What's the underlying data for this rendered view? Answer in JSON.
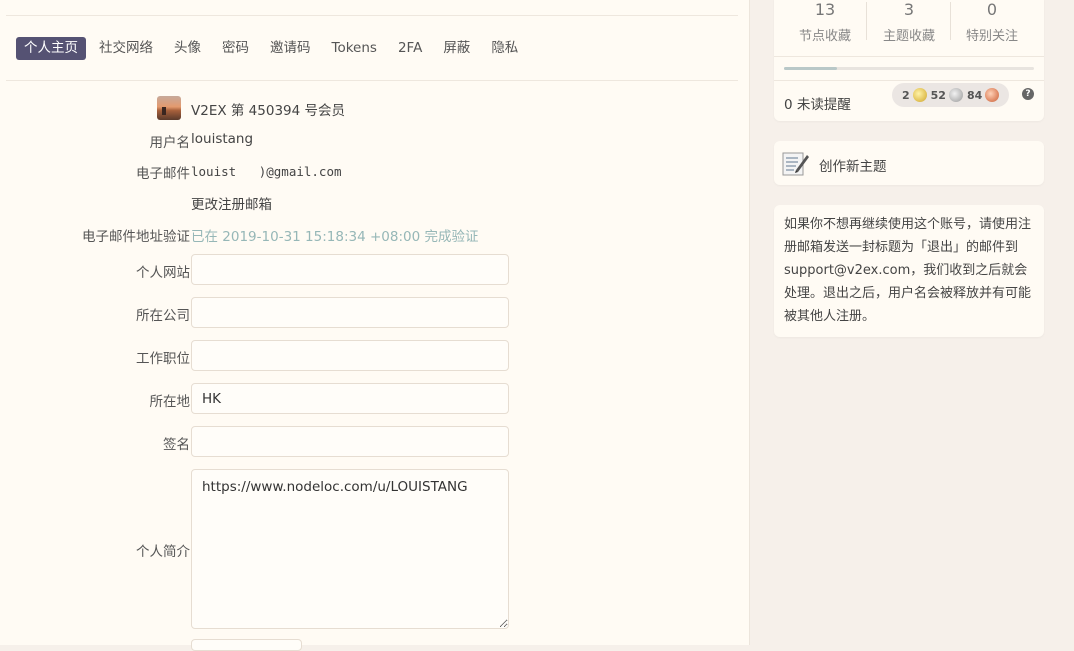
{
  "tabs": [
    "个人主页",
    "社交网络",
    "头像",
    "密码",
    "邀请码",
    "Tokens",
    "2FA",
    "屏蔽",
    "隐私"
  ],
  "profile": {
    "member_text": "V2EX 第 450394 号会员",
    "username_label": "用户名",
    "username": "louistang",
    "email_label": "电子邮件",
    "email": "louist   )@gmail.com",
    "change_email_link": "更改注册邮箱",
    "verify_label": "电子邮件地址验证",
    "verify_status": "已在 2019-10-31 15:18:34 +08:00 完成验证",
    "website_label": "个人网站",
    "website": "",
    "company_label": "所在公司",
    "company": "",
    "title_label": "工作职位",
    "title": "",
    "location_label": "所在地",
    "location": "HK",
    "signature_label": "签名",
    "signature": "",
    "bio_label": "个人简介",
    "bio": "https://www.nodeloc.com/u/LOUISTANG"
  },
  "stats": [
    {
      "count": "13",
      "label": "节点收藏"
    },
    {
      "count": "3",
      "label": "主题收藏"
    },
    {
      "count": "0",
      "label": "特别关注"
    }
  ],
  "unread": "0 未读提醒",
  "coins": {
    "gold": "2",
    "silver": "52",
    "bronze": "84"
  },
  "help_glyph": "?",
  "create_topic": "创作新主题",
  "notice": "如果你不想再继续使用这个账号，请使用注册邮箱发送一封标题为「退出」的邮件到 support@v2ex.com，我们收到之后就会处理。退出之后，用户名会被释放并有可能被其他人注册。"
}
